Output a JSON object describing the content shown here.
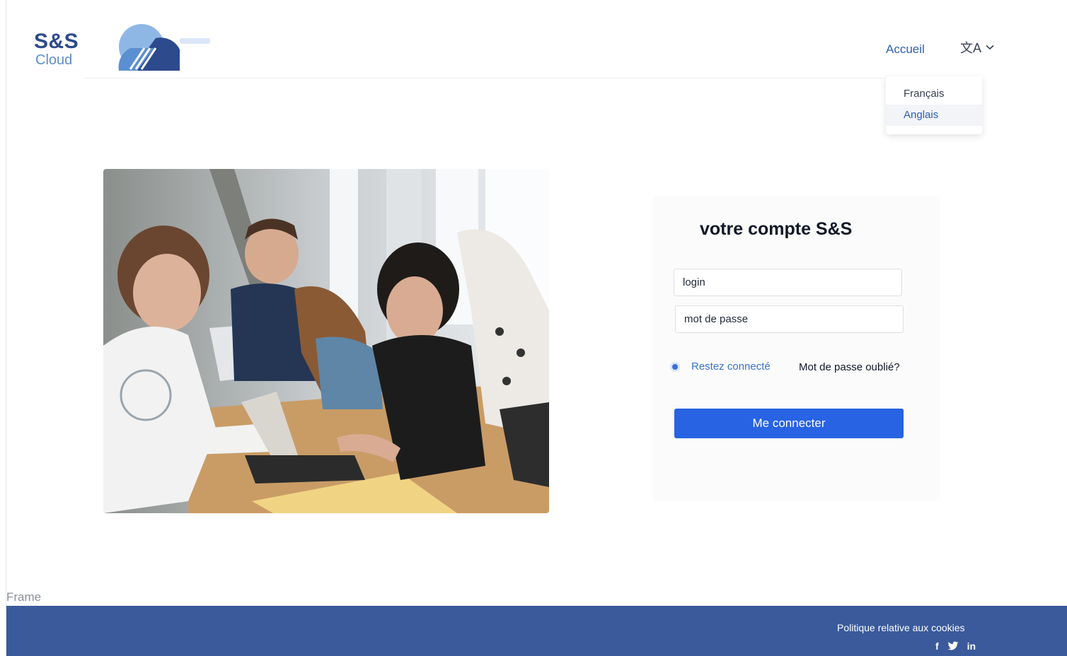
{
  "brand": {
    "name": "S&S",
    "sub": "Cloud"
  },
  "nav": {
    "home": "Accueil",
    "language_icon": "translate-icon",
    "chevron_icon": "chevron-down-icon"
  },
  "language_menu": {
    "options": [
      "Français",
      "Anglais"
    ],
    "highlighted": "Anglais"
  },
  "photo": {
    "description_icon": "students-photo"
  },
  "login": {
    "title": "votre compte S&S",
    "login_placeholder": "login",
    "password_placeholder": "mot de passe",
    "remember_label": "Restez connecté",
    "remember_checked": true,
    "forgot_label": "Mot de passe oublié?",
    "submit_label": "Me connecter"
  },
  "frame_label": "Frame",
  "footer": {
    "cookies": "Politique relative aux cookies",
    "social": {
      "facebook": "f",
      "twitter_icon": "twitter-icon",
      "linkedin": "in"
    }
  },
  "colors": {
    "accent": "#2763e3",
    "footer": "#3a5a9b",
    "brand_dark": "#2c4a8c",
    "brand_light": "#5b8fd1"
  }
}
